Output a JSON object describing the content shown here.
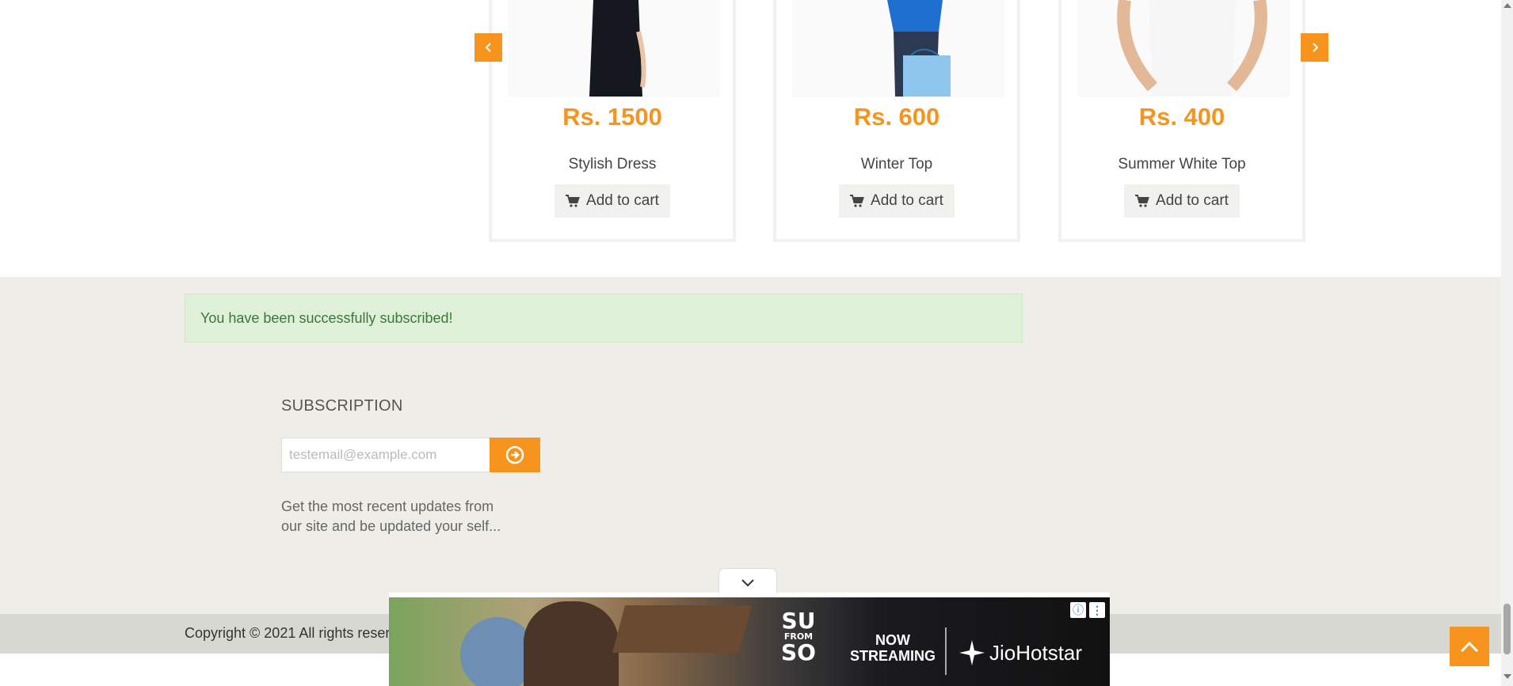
{
  "carousel": {
    "products": [
      {
        "price": "Rs. 1500",
        "name": "Stylish Dress",
        "cart_label": "Add to cart"
      },
      {
        "price": "Rs. 600",
        "name": "Winter Top",
        "cart_label": "Add to cart"
      },
      {
        "price": "Rs. 400",
        "name": "Summer White Top",
        "cart_label": "Add to cart"
      }
    ],
    "prev_icon": "chevron-left-icon",
    "next_icon": "chevron-right-icon"
  },
  "alert": {
    "message": "You have been successfully subscribed!"
  },
  "subscription": {
    "title": "SUBSCRIPTION",
    "placeholder": "testemail@example.com",
    "submit_icon": "circle-arrow-right-icon",
    "description": "Get the most recent updates from our site and be updated your self..."
  },
  "footer": {
    "copyright": "Copyright © 2021 All rights reserv"
  },
  "ad": {
    "logo_line1": "SU",
    "logo_line2": "FROM",
    "logo_line3": "SO",
    "streaming": "NOW STREAMING",
    "brand": "JioHotstar"
  },
  "colors": {
    "accent": "#f7941d",
    "alert_bg": "#dff0d8",
    "alert_text": "#3c763d",
    "footer_bg": "#eeede8"
  }
}
